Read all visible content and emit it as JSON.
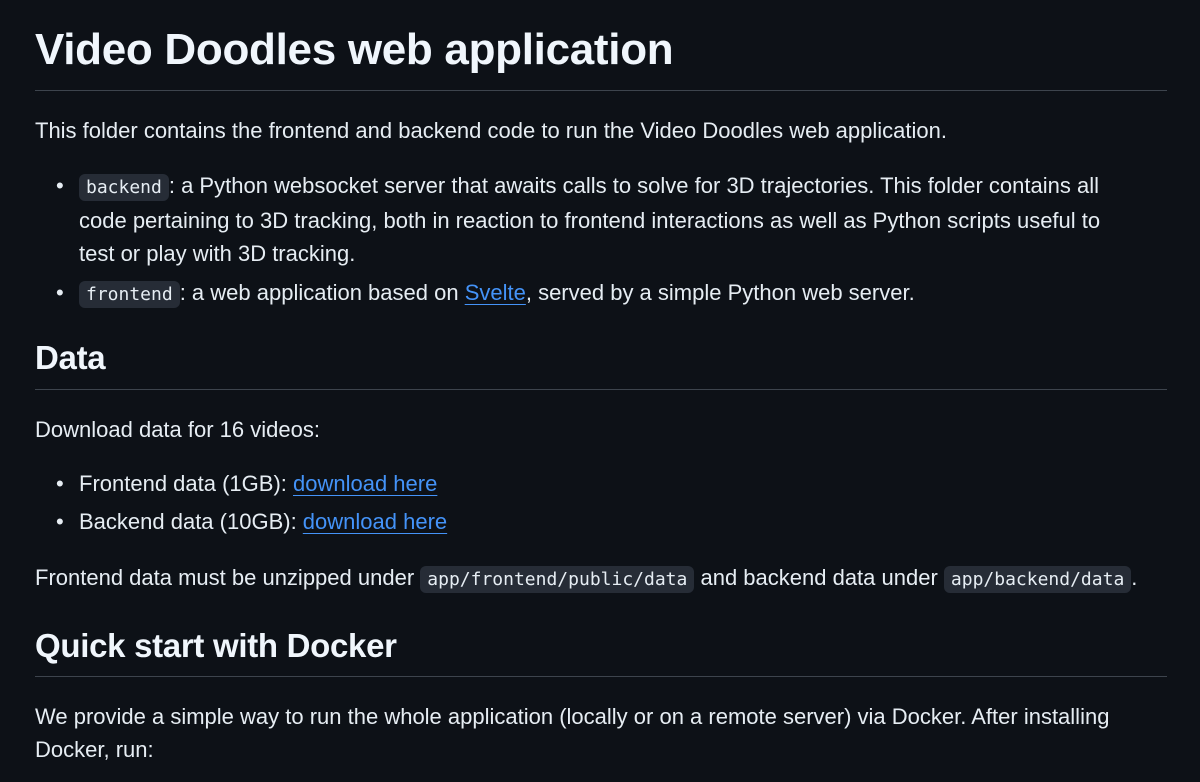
{
  "title": "Video Doodles web application",
  "intro": "This folder contains the frontend and backend code to run the Video Doodles web application.",
  "folders": [
    {
      "code": "backend",
      "text": ": a Python websocket server that awaits calls to solve for 3D trajectories. This folder contains all code pertaining to 3D tracking, both in reaction to frontend interactions as well as Python scripts useful to test or play with 3D tracking."
    },
    {
      "code": "frontend",
      "text_before": ": a web application based on ",
      "link": "Svelte",
      "text_after": ", served by a simple Python web server."
    }
  ],
  "data_section": {
    "heading": "Data",
    "intro": "Download data for 16 videos:",
    "downloads": [
      {
        "label": "Frontend data (1GB): ",
        "link": "download here"
      },
      {
        "label": "Backend data (10GB): ",
        "link": "download here"
      }
    ],
    "unzip_text_1": "Frontend data must be unzipped under ",
    "unzip_code_1": "app/frontend/public/data",
    "unzip_text_2": " and backend data under ",
    "unzip_code_2": "app/backend/data",
    "unzip_text_3": "."
  },
  "docker_section": {
    "heading": "Quick start with Docker",
    "text": "We provide a simple way to run the whole application (locally or on a remote server) via Docker. After installing Docker, run:"
  }
}
